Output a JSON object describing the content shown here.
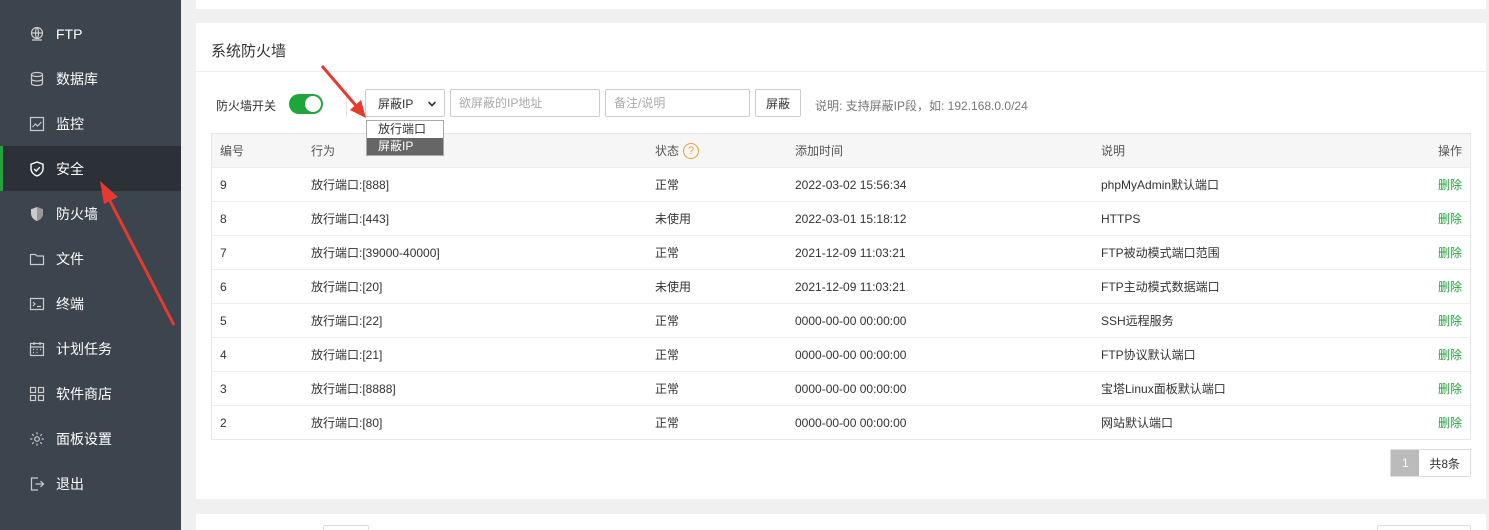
{
  "sidebar": {
    "items": [
      {
        "label": "FTP",
        "icon": "ftp-icon"
      },
      {
        "label": "数据库",
        "icon": "database-icon"
      },
      {
        "label": "监控",
        "icon": "monitor-icon"
      },
      {
        "label": "安全",
        "icon": "shield-icon",
        "active": true
      },
      {
        "label": "防火墙",
        "icon": "firewall-icon"
      },
      {
        "label": "文件",
        "icon": "folder-icon"
      },
      {
        "label": "终端",
        "icon": "terminal-icon"
      },
      {
        "label": "计划任务",
        "icon": "calendar-icon"
      },
      {
        "label": "软件商店",
        "icon": "apps-icon"
      },
      {
        "label": "面板设置",
        "icon": "gear-icon"
      },
      {
        "label": "退出",
        "icon": "logout-icon"
      }
    ]
  },
  "firewall": {
    "title": "系统防火墙",
    "switch_label": "防火墙开关",
    "switch_on": true,
    "select_value": "屏蔽IP",
    "dropdown_options": [
      "放行端口",
      "屏蔽IP"
    ],
    "ip_placeholder": "欲屏蔽的IP地址",
    "note_placeholder": "备注/说明",
    "block_button": "屏蔽",
    "hint": "说明: 支持屏蔽IP段，如: 192.168.0.0/24"
  },
  "table": {
    "headers": [
      "编号",
      "行为",
      "状态",
      "添加时间",
      "说明",
      "操作"
    ],
    "status_help": "?",
    "rows": [
      {
        "id": "9",
        "action": "放行端口:[888]",
        "status": "正常",
        "time": "2022-03-02 15:56:34",
        "desc": "phpMyAdmin默认端口",
        "op": "删除"
      },
      {
        "id": "8",
        "action": "放行端口:[443]",
        "status": "未使用",
        "time": "2022-03-01 15:18:12",
        "desc": "HTTPS",
        "op": "删除"
      },
      {
        "id": "7",
        "action": "放行端口:[39000-40000]",
        "status": "正常",
        "time": "2021-12-09 11:03:21",
        "desc": "FTP被动模式端口范围",
        "op": "删除"
      },
      {
        "id": "6",
        "action": "放行端口:[20]",
        "status": "未使用",
        "time": "2021-12-09 11:03:21",
        "desc": "FTP主动模式数据端口",
        "op": "删除"
      },
      {
        "id": "5",
        "action": "放行端口:[22]",
        "status": "正常",
        "time": "0000-00-00 00:00:00",
        "desc": "SSH远程服务",
        "op": "删除"
      },
      {
        "id": "4",
        "action": "放行端口:[21]",
        "status": "正常",
        "time": "0000-00-00 00:00:00",
        "desc": "FTP协议默认端口",
        "op": "删除"
      },
      {
        "id": "3",
        "action": "放行端口:[8888]",
        "status": "正常",
        "time": "0000-00-00 00:00:00",
        "desc": "宝塔Linux面板默认端口",
        "op": "删除"
      },
      {
        "id": "2",
        "action": "放行端口:[80]",
        "status": "正常",
        "time": "0000-00-00 00:00:00",
        "desc": "网站默认端口",
        "op": "删除"
      }
    ]
  },
  "pagination": {
    "current": "1",
    "total": "共8条"
  },
  "colors": {
    "accent": "#20a53a",
    "sidebar_bg": "#3c444d",
    "annotation": "#e8392f"
  }
}
